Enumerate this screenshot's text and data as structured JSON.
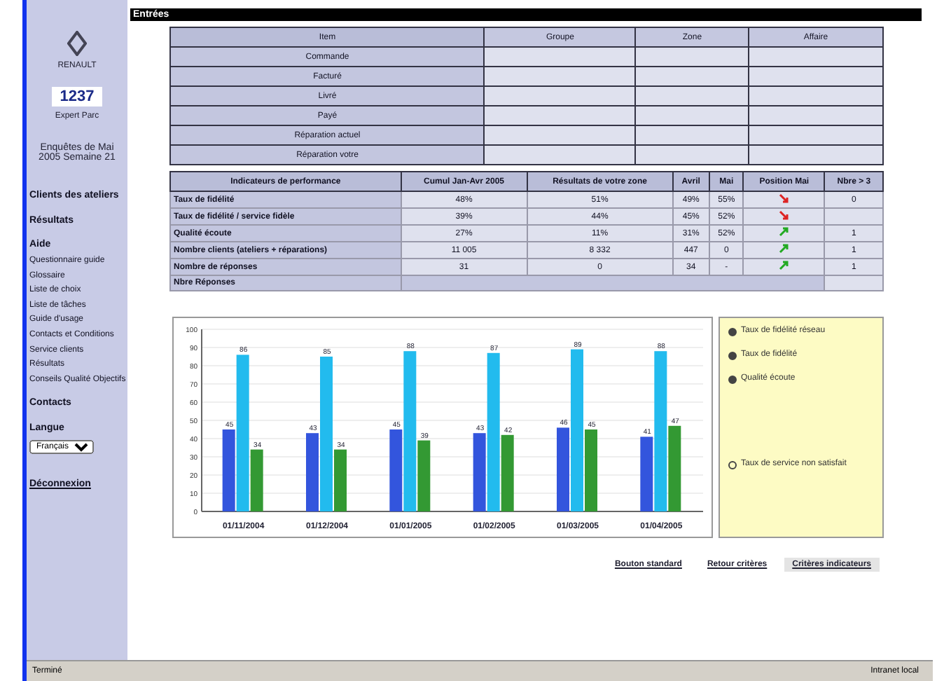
{
  "sidebar": {
    "logo_caption": "RENAULT",
    "code": "1237",
    "code_caption": "Expert Parc",
    "period": "Enquêtes de Mai 2005 Semaine 21",
    "links": [
      {
        "label": "Clients des ateliers",
        "kind": "main"
      },
      {
        "label": "Résultats",
        "kind": "main"
      },
      {
        "label": "Aide",
        "kind": "main"
      },
      {
        "label": "Questionnaire guide",
        "kind": "sub"
      },
      {
        "label": "Glossaire",
        "kind": "sub"
      },
      {
        "label": "Liste de choix",
        "kind": "sub"
      },
      {
        "label": "Liste de tâches",
        "kind": "sub"
      },
      {
        "label": "Guide d'usage",
        "kind": "sub"
      },
      {
        "label": "Contacts et Conditions",
        "kind": "sub"
      },
      {
        "label": "Service clients",
        "kind": "sub"
      },
      {
        "label": "Résultats",
        "kind": "sub"
      },
      {
        "label": "Conseils Qualité Objectifs",
        "kind": "sub"
      },
      {
        "label": "Contacts",
        "kind": "main"
      }
    ],
    "language_label": "Langue",
    "language": "Français",
    "logout": "Déconnexion"
  },
  "section_title": "Entrées",
  "items_table": {
    "columns": [
      "Item",
      "Groupe",
      "Zone",
      "Affaire"
    ],
    "rows": [
      "Commande",
      "Facturé",
      "Livré",
      "Payé",
      "Réparation actuel",
      "Réparation votre"
    ]
  },
  "kpi_table": {
    "columns": [
      "Indicateurs de performance",
      "Cumul Jan-Avr 2005",
      "Résultats de votre zone",
      "Avril",
      "Mai",
      "Position Mai",
      "Nbre > 3"
    ],
    "rows": [
      {
        "cells": [
          "Taux de fidélité",
          "48%",
          "51%",
          "49%",
          "55%"
        ],
        "trend_up": false,
        "count": "0"
      },
      {
        "cells": [
          "Taux de fidélité / service fidèle",
          "39%",
          "44%",
          "45%",
          "52%"
        ],
        "trend_up": false
      },
      {
        "cells": [
          "Qualité écoute",
          "27%",
          "11%",
          "31%",
          "52%"
        ],
        "trend_up": true,
        "count": "1"
      },
      {
        "cells": [
          "Nombre clients (ateliers + réparations)",
          "11 005",
          "8 332",
          "447",
          "0"
        ],
        "trend_up": true,
        "count": "1"
      },
      {
        "cells": [
          "Nombre de réponses",
          "31",
          "0",
          "34",
          "-"
        ],
        "trend_up": true,
        "count": "1"
      },
      {
        "cells": [
          "Nbre Réponses"
        ]
      }
    ]
  },
  "chart": {
    "chart_data": {
      "type": "bar",
      "categories": [
        "01/11/2004",
        "01/12/2004",
        "01/01/2005",
        "01/02/2005",
        "01/03/2005",
        "01/04/2005"
      ],
      "ylim": [
        0,
        100
      ],
      "yticks": [
        0,
        10,
        20,
        30,
        40,
        50,
        60,
        70,
        80,
        90,
        100
      ],
      "data_labels": true,
      "grid": true,
      "series": [
        {
          "name": "Taux de fidélité réseau",
          "color": "#3355dd",
          "values": [
            45,
            43,
            45,
            43,
            46,
            41
          ]
        },
        {
          "name": "Taux de fidélité",
          "color": "#22bbee",
          "values": [
            86,
            85,
            88,
            87,
            89,
            88
          ]
        },
        {
          "name": "Qualité écoute",
          "color": "#339933",
          "values": [
            34,
            34,
            39,
            42,
            45,
            47
          ]
        }
      ]
    },
    "extra_legend": [
      {
        "label": "Taux de service non satisfait",
        "filled": false
      }
    ]
  },
  "buttons": [
    {
      "label": "Bouton standard",
      "kind": "link"
    },
    {
      "label": "Retour critères",
      "kind": "link"
    },
    {
      "label": "Critères indicateurs",
      "kind": "button"
    }
  ],
  "status_bar": {
    "left": "Terminé",
    "right": "Intranet local"
  }
}
